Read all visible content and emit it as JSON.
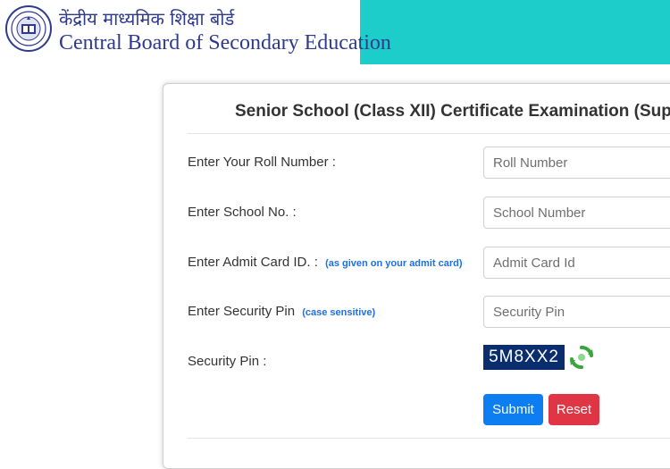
{
  "header": {
    "org_hindi": "केंद्रीय माध्यमिक शिक्षा बोर्ड",
    "org_english": "Central Board of Secondary Education",
    "emblem_icon": "cbse-emblem-icon",
    "bar_color": "#1ccdc9"
  },
  "form": {
    "title": "Senior School (Class XII) Certificate Examination (Supplementary)",
    "roll": {
      "label": "Enter Your Roll Number :",
      "placeholder": "Roll Number",
      "value": ""
    },
    "school": {
      "label": "Enter School No. :",
      "placeholder": "School Number",
      "value": ""
    },
    "admit": {
      "label": "Enter Admit Card ID. :",
      "hint": "(as given on your admit card)",
      "placeholder": "Admit Card Id",
      "value": ""
    },
    "security": {
      "label": "Enter Security Pin",
      "hint": "(case sensitive)",
      "placeholder": "Security Pin",
      "value": ""
    },
    "captcha": {
      "label": "Security Pin :",
      "code": "5M8XX2",
      "refresh_icon": "refresh-icon"
    },
    "buttons": {
      "submit": "Submit",
      "reset": "Reset"
    },
    "colors": {
      "submit": "#0d7ef2",
      "reset": "#e03545",
      "hint": "#1f6fe5",
      "captcha_bg": "#0a2d6e"
    }
  }
}
